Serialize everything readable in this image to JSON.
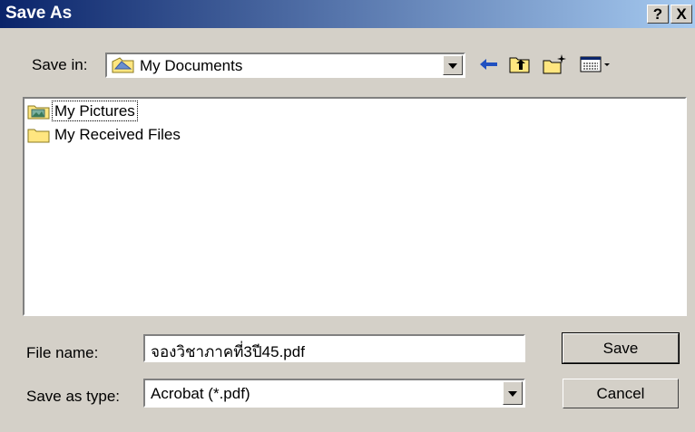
{
  "window": {
    "title": "Save As"
  },
  "titlebar": {
    "help_label": "?",
    "close_label": "X"
  },
  "save_in": {
    "label": "Save in:",
    "value": "My Documents",
    "icon": "my-documents-icon"
  },
  "toolbar": {
    "back_icon": "back-arrow-icon",
    "up_icon": "up-folder-icon",
    "new_folder_icon": "new-folder-icon",
    "view_icon": "view-menu-icon"
  },
  "files": [
    {
      "name": "My Pictures",
      "icon": "my-pictures-folder-icon"
    },
    {
      "name": "My Received Files",
      "icon": "folder-icon"
    }
  ],
  "file_name": {
    "label": "File name:",
    "value": "จองวิชาภาคที่3ปี45.pdf"
  },
  "save_type": {
    "label": "Save as type:",
    "value": "Acrobat (*.pdf)"
  },
  "buttons": {
    "save": "Save",
    "cancel": "Cancel"
  },
  "colors": {
    "title_start": "#0a246a",
    "title_end": "#a6caf0",
    "face": "#d4d0c8",
    "folder": "#ffe680"
  }
}
